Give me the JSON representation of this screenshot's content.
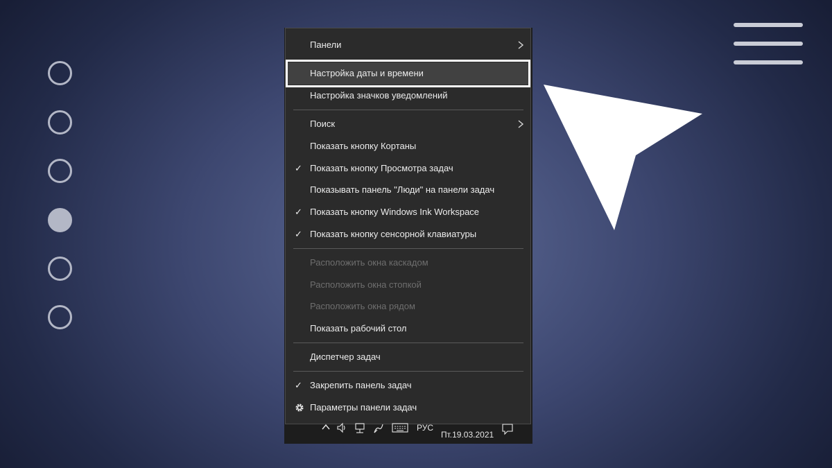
{
  "menu": {
    "items": [
      {
        "label": "Панели",
        "submenu": true,
        "checked": false,
        "disabled": false
      },
      {
        "label": "Настройка даты и времени",
        "submenu": false,
        "checked": false,
        "disabled": false,
        "highlighted": true
      },
      {
        "label": "Настройка значков уведомлений",
        "submenu": false,
        "checked": false,
        "disabled": false
      },
      {
        "label": "Поиск",
        "submenu": true,
        "checked": false,
        "disabled": false
      },
      {
        "label": "Показать кнопку Кортаны",
        "submenu": false,
        "checked": false,
        "disabled": false
      },
      {
        "label": "Показать кнопку Просмотра задач",
        "submenu": false,
        "checked": true,
        "disabled": false
      },
      {
        "label": "Показывать панель \"Люди\" на панели задач",
        "submenu": false,
        "checked": false,
        "disabled": false
      },
      {
        "label": "Показать кнопку Windows Ink Workspace",
        "submenu": false,
        "checked": true,
        "disabled": false
      },
      {
        "label": "Показать кнопку сенсорной клавиатуры",
        "submenu": false,
        "checked": true,
        "disabled": false
      },
      {
        "label": "Расположить окна каскадом",
        "submenu": false,
        "checked": false,
        "disabled": true
      },
      {
        "label": "Расположить окна стопкой",
        "submenu": false,
        "checked": false,
        "disabled": true
      },
      {
        "label": "Расположить окна рядом",
        "submenu": false,
        "checked": false,
        "disabled": true
      },
      {
        "label": "Показать рабочий стол",
        "submenu": false,
        "checked": false,
        "disabled": false
      },
      {
        "label": "Диспетчер задач",
        "submenu": false,
        "checked": false,
        "disabled": false
      },
      {
        "label": "Закрепить панель задач",
        "submenu": false,
        "checked": true,
        "disabled": false
      },
      {
        "label": "Параметры панели задач",
        "submenu": false,
        "checked": false,
        "disabled": false,
        "icon": "gear-icon"
      }
    ],
    "check_glyph": "✓"
  },
  "tray": {
    "language": "РУС",
    "date": "Пт.19.03.2021",
    "icons": [
      "chevron-up-icon",
      "volume-icon",
      "network-icon",
      "pen-icon",
      "keyboard-icon",
      "notification-icon"
    ]
  },
  "overlay": {
    "page_dots": 6,
    "active_dot": 4,
    "colors": {
      "accent": "#b3b7c6",
      "highlight_frame": "#ffffff",
      "menu_bg": "#2b2b2b"
    }
  }
}
